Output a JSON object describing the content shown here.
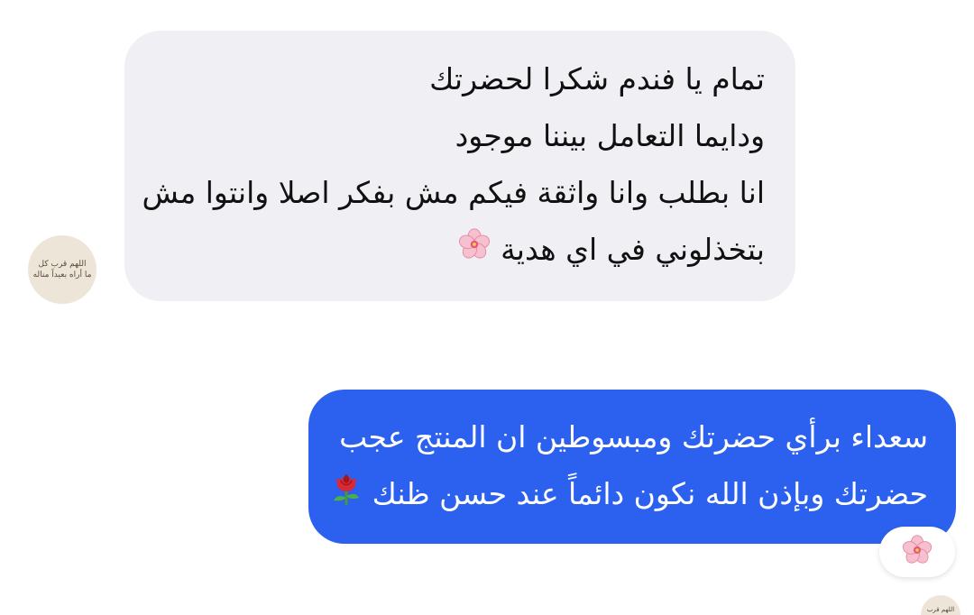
{
  "incoming_message": {
    "lines": [
      "تمام يا فندم شكرا لحضرتك",
      "ودايما التعامل بيننا موجود",
      "انا بطلب وانا واثقة فيكم مش بفكر اصلا وانتوا مش",
      "بتخذلوني في اي هدية"
    ],
    "emoji_icon": "cherry-blossom-icon",
    "bubble_color": "#f0f0f4",
    "text_color": "#111111"
  },
  "incoming_avatar": {
    "text_lines": [
      "اللهم قرب كل",
      "ما أراه بعيداً مناله"
    ],
    "background": "#ede6d8"
  },
  "outgoing_message": {
    "lines": [
      "سعداء برأي حضرتك ومبسوطين ان المنتج عجب",
      "حضرتك وبإذن الله نكون دائماً عند حسن ظنك"
    ],
    "emoji_icon": "rose-icon",
    "bubble_color": "#2b61ee",
    "text_color": "#ffffff"
  },
  "reaction": {
    "emoji_icon": "cherry-blossom-icon"
  },
  "outgoing_avatar": {
    "text": "اللهم قرب",
    "background": "#ede6d8"
  }
}
